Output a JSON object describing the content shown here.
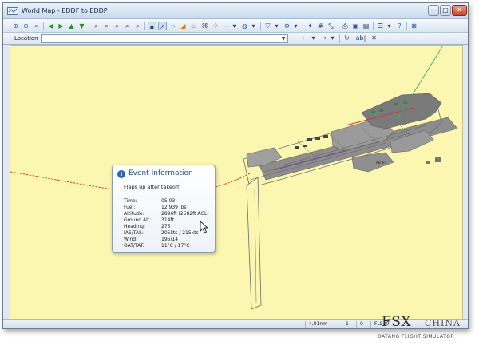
{
  "window": {
    "title": "World Map - EDDF to EDDP",
    "min_glyph": "—",
    "max_glyph": "□",
    "close_glyph": "✕"
  },
  "toolbar": {
    "icons": [
      "zoom-in-icon",
      "zoom-out-icon",
      "zoom-fit-icon",
      "nav-back-icon",
      "nav-forward-icon",
      "nav-up-icon",
      "nav-down-icon",
      "search-icon",
      "search-airport-icon",
      "search-navaid-icon",
      "search-fix-icon",
      "select-icon",
      "measure-icon",
      "route-icon",
      "airspace-icon",
      "weather-icon",
      "layers-icon",
      "filter-icon",
      "settings-icon",
      "print-icon",
      "save-icon",
      "export-icon",
      "options-icon",
      "help-icon",
      "exit-icon"
    ]
  },
  "location_bar": {
    "label": "Location",
    "value": "",
    "nav_back": "←",
    "nav_forward": "→",
    "abc": "ab|",
    "clear": "✕"
  },
  "map": {
    "event_label": "Flaps up",
    "route_color": "#cc2a2a",
    "taxiway_color": "#7b7b7b",
    "tarmac_color": "#8a8a8a",
    "label_apron": "Apron"
  },
  "popup": {
    "title": "Event Information",
    "subtitle": "Flaps up after takeoff",
    "rows": [
      {
        "key": "Time:",
        "value": "05:03"
      },
      {
        "key": "Fuel:",
        "value": "12.939 lbs"
      },
      {
        "key": "Altitude:",
        "value": "2896ft (2582ft AGL)"
      },
      {
        "key": "Ground Alt.:",
        "value": "314ft"
      },
      {
        "key": "Heading:",
        "value": "275"
      },
      {
        "key": "IAS/TAS:",
        "value": "205kts / 215kts"
      },
      {
        "key": "Wind:",
        "value": "195/14"
      },
      {
        "key": "OAT/TAT:",
        "value": "11°C / 17°C"
      }
    ]
  },
  "statusbar": {
    "distance": "4,01nm",
    "count_a": "1",
    "count_b": "0",
    "flight_level": "FL540"
  },
  "watermark": {
    "main": "FSX",
    "china": "CHINA",
    "sub": "DATANG FLIGHT SIMULATOR"
  }
}
